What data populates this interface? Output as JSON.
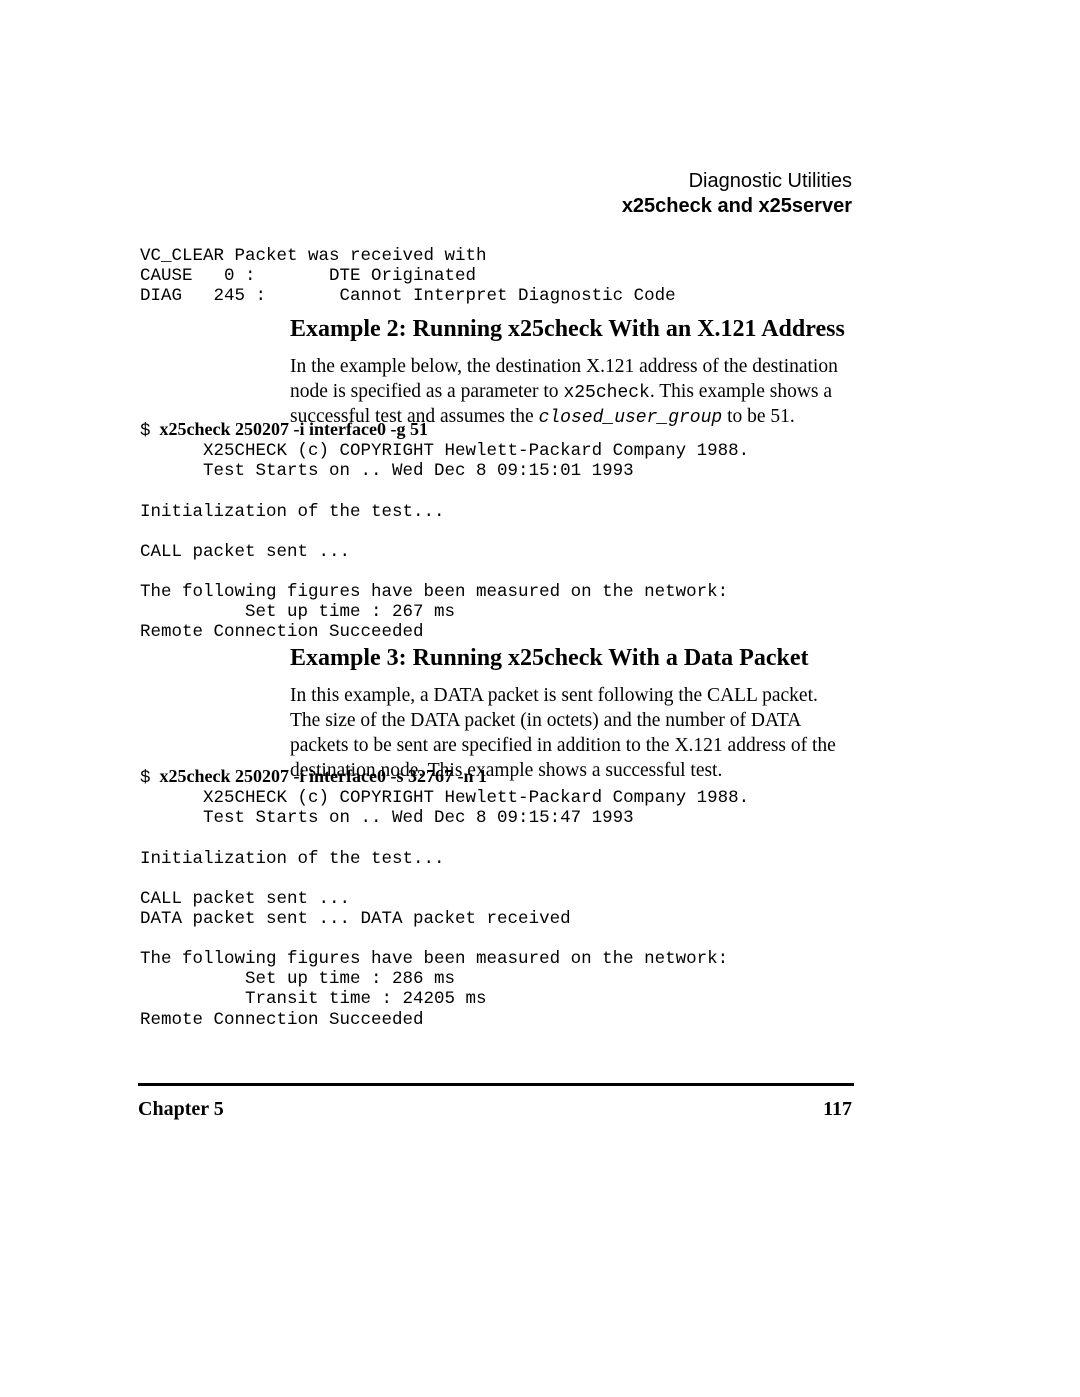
{
  "header": {
    "line1": "Diagnostic Utilities",
    "line2": "x25check and x25server"
  },
  "code1": "VC_CLEAR Packet was received with\nCAUSE   0 :       DTE Originated\nDIAG   245 :       Cannot Interpret Diagnostic Code",
  "heading2": "Example 2: Running x25check With an X.121 Address",
  "para2_a": "In the example below, the destination X.121 address of the destination node is specified as a parameter to ",
  "para2_code": "x25check",
  "para2_b": ". This example shows a successful test and assumes the ",
  "para2_italic": "closed_user_group",
  "para2_c": " to be 51.",
  "cmd2_dollar": "$",
  "cmd2_text": "  x25check 250207 -i interface0 -g 51",
  "code2": "      X25CHECK (c) COPYRIGHT Hewlett-Packard Company 1988.\n      Test Starts on .. Wed Dec 8 09:15:01 1993\n\nInitialization of the test...\n\nCALL packet sent ...\n\nThe following figures have been measured on the network:\n          Set up time : 267 ms\nRemote Connection Succeeded",
  "heading3": "Example 3: Running x25check With a Data Packet",
  "para3": "In this example, a DATA packet is sent following the CALL packet. The size of the DATA packet (in octets) and the number of DATA packets to be sent are specified in addition to the X.121 address of the destination node. This example shows a successful test.",
  "cmd3_dollar": "$",
  "cmd3_text": "  x25check 250207 -i interface0 -s 32767 -n 1",
  "code3": "      X25CHECK (c) COPYRIGHT Hewlett-Packard Company 1988.\n      Test Starts on .. Wed Dec 8 09:15:47 1993\n\nInitialization of the test...\n\nCALL packet sent ...\nDATA packet sent ... DATA packet received\n\nThe following figures have been measured on the network:\n          Set up time : 286 ms\n          Transit time : 24205 ms\nRemote Connection Succeeded",
  "footer": {
    "left": "Chapter 5",
    "right": "117"
  }
}
